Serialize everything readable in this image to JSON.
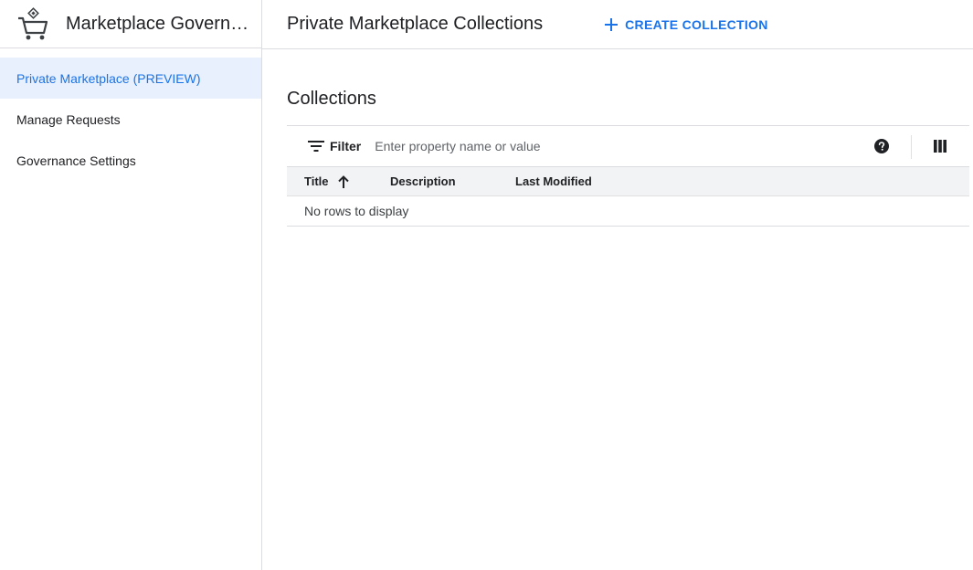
{
  "sidebar": {
    "brand_title": "Marketplace Governa…",
    "brand_icon": "shopping-cart-icon",
    "items": [
      {
        "label": "Private Marketplace (PREVIEW)",
        "active": true
      },
      {
        "label": "Manage Requests",
        "active": false
      },
      {
        "label": "Governance Settings",
        "active": false
      }
    ]
  },
  "topbar": {
    "title": "Private Marketplace Collections",
    "create_label": "CREATE COLLECTION"
  },
  "main": {
    "section_title": "Collections",
    "filter": {
      "label": "Filter",
      "placeholder": "Enter property name or value"
    },
    "table": {
      "columns": [
        "Title",
        "Description",
        "Last Modified"
      ],
      "sort_column": "Title",
      "sort_direction": "ascending",
      "empty_message": "No rows to display"
    }
  },
  "colors": {
    "accent": "#1a73e8",
    "active_bg": "#e8f0fe",
    "border": "#dadce0",
    "header_bg": "#f1f3f4"
  }
}
